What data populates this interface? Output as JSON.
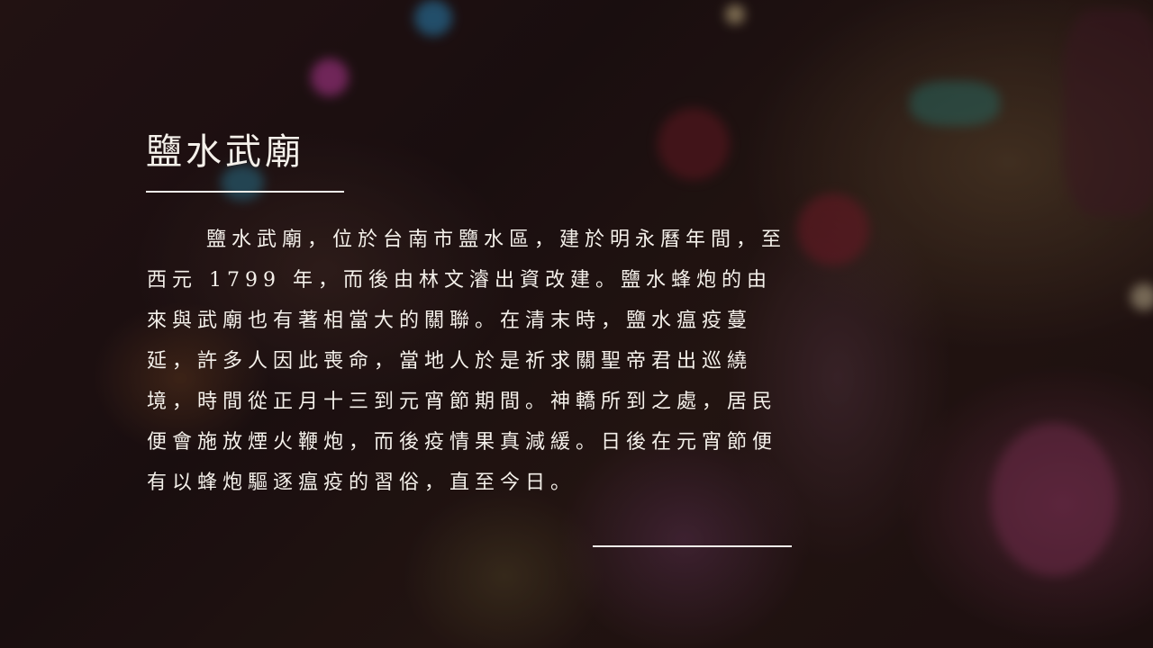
{
  "slide": {
    "title": "鹽水武廟",
    "body": "鹽水武廟，位於台南市鹽水區，建於明永曆年間，至西元 1799 年，而後由林文濬出資改建。鹽水蜂炮的由來與武廟也有著相當大的關聯。在清末時，鹽水瘟疫蔓延，許多人因此喪命，當地人於是祈求關聖帝君出巡繞境，時間從正月十三到元宵節期間。神轎所到之處，居民便會施放煙火鞭炮，而後疫情果真減緩。日後在元宵節便有以蜂炮驅逐瘟疫的習俗，直至今日。"
  },
  "colors": {
    "text": "#f4f0ea",
    "rule": "#f4f0ea"
  }
}
